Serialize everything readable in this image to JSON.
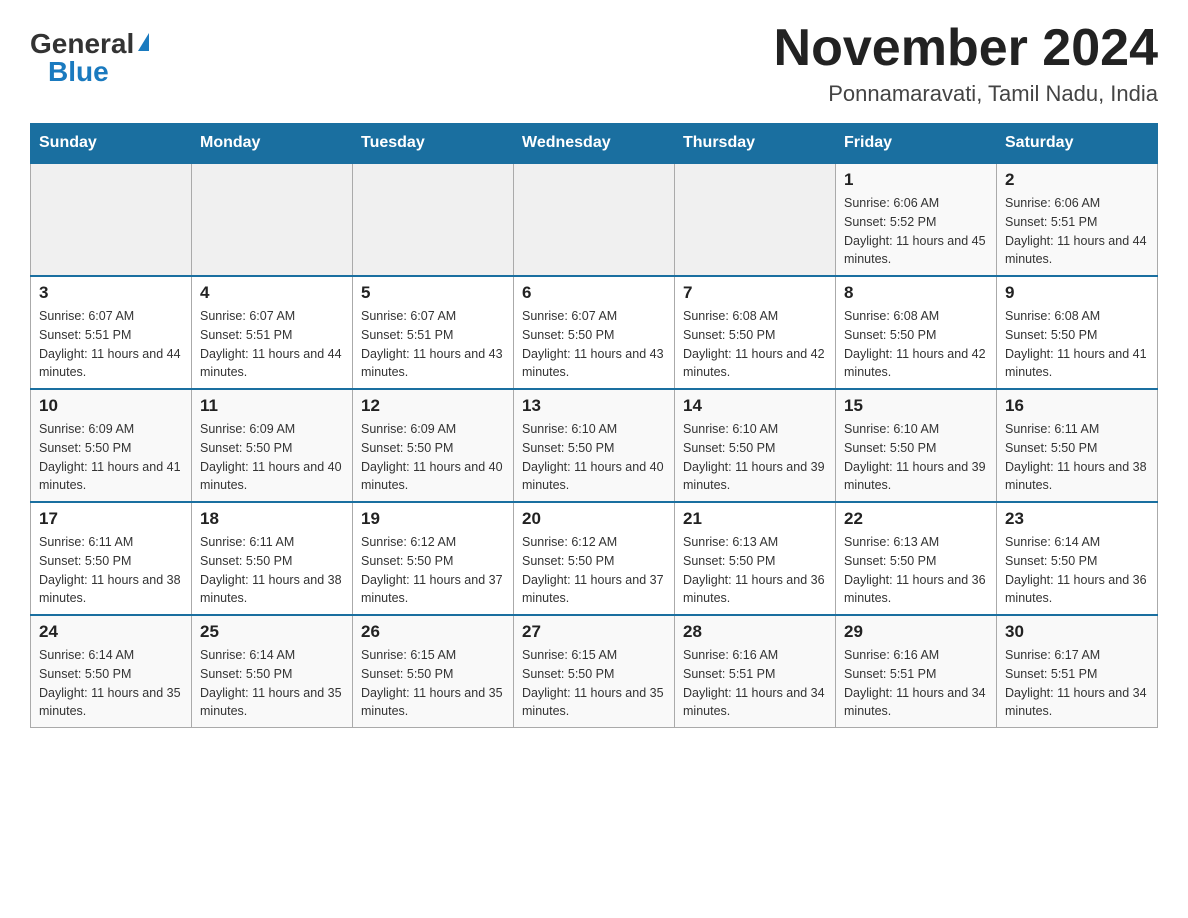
{
  "logo": {
    "general": "General",
    "blue": "Blue",
    "triangle": "▲"
  },
  "title": "November 2024",
  "location": "Ponnamaravati, Tamil Nadu, India",
  "weekdays": [
    "Sunday",
    "Monday",
    "Tuesday",
    "Wednesday",
    "Thursday",
    "Friday",
    "Saturday"
  ],
  "weeks": [
    [
      {
        "day": "",
        "info": ""
      },
      {
        "day": "",
        "info": ""
      },
      {
        "day": "",
        "info": ""
      },
      {
        "day": "",
        "info": ""
      },
      {
        "day": "",
        "info": ""
      },
      {
        "day": "1",
        "info": "Sunrise: 6:06 AM\nSunset: 5:52 PM\nDaylight: 11 hours and 45 minutes."
      },
      {
        "day": "2",
        "info": "Sunrise: 6:06 AM\nSunset: 5:51 PM\nDaylight: 11 hours and 44 minutes."
      }
    ],
    [
      {
        "day": "3",
        "info": "Sunrise: 6:07 AM\nSunset: 5:51 PM\nDaylight: 11 hours and 44 minutes."
      },
      {
        "day": "4",
        "info": "Sunrise: 6:07 AM\nSunset: 5:51 PM\nDaylight: 11 hours and 44 minutes."
      },
      {
        "day": "5",
        "info": "Sunrise: 6:07 AM\nSunset: 5:51 PM\nDaylight: 11 hours and 43 minutes."
      },
      {
        "day": "6",
        "info": "Sunrise: 6:07 AM\nSunset: 5:50 PM\nDaylight: 11 hours and 43 minutes."
      },
      {
        "day": "7",
        "info": "Sunrise: 6:08 AM\nSunset: 5:50 PM\nDaylight: 11 hours and 42 minutes."
      },
      {
        "day": "8",
        "info": "Sunrise: 6:08 AM\nSunset: 5:50 PM\nDaylight: 11 hours and 42 minutes."
      },
      {
        "day": "9",
        "info": "Sunrise: 6:08 AM\nSunset: 5:50 PM\nDaylight: 11 hours and 41 minutes."
      }
    ],
    [
      {
        "day": "10",
        "info": "Sunrise: 6:09 AM\nSunset: 5:50 PM\nDaylight: 11 hours and 41 minutes."
      },
      {
        "day": "11",
        "info": "Sunrise: 6:09 AM\nSunset: 5:50 PM\nDaylight: 11 hours and 40 minutes."
      },
      {
        "day": "12",
        "info": "Sunrise: 6:09 AM\nSunset: 5:50 PM\nDaylight: 11 hours and 40 minutes."
      },
      {
        "day": "13",
        "info": "Sunrise: 6:10 AM\nSunset: 5:50 PM\nDaylight: 11 hours and 40 minutes."
      },
      {
        "day": "14",
        "info": "Sunrise: 6:10 AM\nSunset: 5:50 PM\nDaylight: 11 hours and 39 minutes."
      },
      {
        "day": "15",
        "info": "Sunrise: 6:10 AM\nSunset: 5:50 PM\nDaylight: 11 hours and 39 minutes."
      },
      {
        "day": "16",
        "info": "Sunrise: 6:11 AM\nSunset: 5:50 PM\nDaylight: 11 hours and 38 minutes."
      }
    ],
    [
      {
        "day": "17",
        "info": "Sunrise: 6:11 AM\nSunset: 5:50 PM\nDaylight: 11 hours and 38 minutes."
      },
      {
        "day": "18",
        "info": "Sunrise: 6:11 AM\nSunset: 5:50 PM\nDaylight: 11 hours and 38 minutes."
      },
      {
        "day": "19",
        "info": "Sunrise: 6:12 AM\nSunset: 5:50 PM\nDaylight: 11 hours and 37 minutes."
      },
      {
        "day": "20",
        "info": "Sunrise: 6:12 AM\nSunset: 5:50 PM\nDaylight: 11 hours and 37 minutes."
      },
      {
        "day": "21",
        "info": "Sunrise: 6:13 AM\nSunset: 5:50 PM\nDaylight: 11 hours and 36 minutes."
      },
      {
        "day": "22",
        "info": "Sunrise: 6:13 AM\nSunset: 5:50 PM\nDaylight: 11 hours and 36 minutes."
      },
      {
        "day": "23",
        "info": "Sunrise: 6:14 AM\nSunset: 5:50 PM\nDaylight: 11 hours and 36 minutes."
      }
    ],
    [
      {
        "day": "24",
        "info": "Sunrise: 6:14 AM\nSunset: 5:50 PM\nDaylight: 11 hours and 35 minutes."
      },
      {
        "day": "25",
        "info": "Sunrise: 6:14 AM\nSunset: 5:50 PM\nDaylight: 11 hours and 35 minutes."
      },
      {
        "day": "26",
        "info": "Sunrise: 6:15 AM\nSunset: 5:50 PM\nDaylight: 11 hours and 35 minutes."
      },
      {
        "day": "27",
        "info": "Sunrise: 6:15 AM\nSunset: 5:50 PM\nDaylight: 11 hours and 35 minutes."
      },
      {
        "day": "28",
        "info": "Sunrise: 6:16 AM\nSunset: 5:51 PM\nDaylight: 11 hours and 34 minutes."
      },
      {
        "day": "29",
        "info": "Sunrise: 6:16 AM\nSunset: 5:51 PM\nDaylight: 11 hours and 34 minutes."
      },
      {
        "day": "30",
        "info": "Sunrise: 6:17 AM\nSunset: 5:51 PM\nDaylight: 11 hours and 34 minutes."
      }
    ]
  ]
}
